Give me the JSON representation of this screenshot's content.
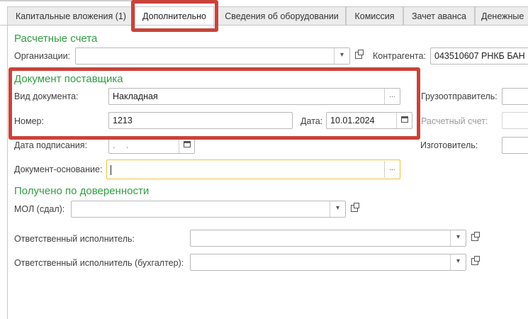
{
  "tabs": [
    {
      "label": "Капитальные вложения (1)"
    },
    {
      "label": "Дополнительно"
    },
    {
      "label": "Сведения об оборудовании"
    },
    {
      "label": "Комиссия"
    },
    {
      "label": "Зачет аванса"
    },
    {
      "label": "Денежные"
    }
  ],
  "accounts": {
    "title": "Расчетные счета",
    "org_label": "Организации:",
    "org_value": "",
    "contractor_label": "Контрагента:",
    "contractor_value": "043510607 РНКБ БАН"
  },
  "supplier_doc": {
    "title": "Документ поставщика",
    "doc_type_label": "Вид документа:",
    "doc_type_value": "Накладная",
    "number_label": "Номер:",
    "number_value": "1213",
    "date_label": "Дата:",
    "date_value": "10.01.2024",
    "shipper_label": "Грузоотправитель:",
    "account_label": "Расчетный счет:",
    "sign_date_label": "Дата подписания:",
    "sign_date_value": ". .",
    "manufacturer_label": "Изготовитель:",
    "basis_label": "Документ-основание:",
    "basis_value": ""
  },
  "proxy": {
    "title": "Получено по доверенности",
    "mol_label": "МОЛ (сдал):",
    "mol_value": "",
    "executor_label": "Ответственный исполнитель:",
    "executor_value": "",
    "accountant_label": "Ответственный исполнитель (бухгалтер):",
    "accountant_value": ""
  },
  "icons": {
    "dropdown": "▾",
    "ellipsis": "...",
    "calendar": "calendar-icon",
    "open": "open-icon"
  },
  "colors": {
    "section_green": "#2f9e41",
    "highlight_red": "#c9433a",
    "focus_yellow": "#f0c23a"
  }
}
